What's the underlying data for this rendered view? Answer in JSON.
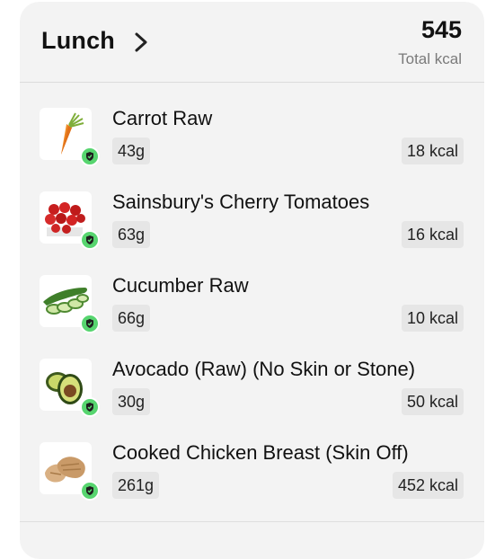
{
  "meal": {
    "title": "Lunch",
    "total_value": "545",
    "total_label": "Total kcal"
  },
  "items": [
    {
      "name": "Carrot Raw",
      "weight": "43g",
      "kcal": "18 kcal",
      "icon": "carrot-icon"
    },
    {
      "name": "Sainsbury's Cherry Tomatoes",
      "weight": "63g",
      "kcal": "16 kcal",
      "icon": "tomatoes-icon"
    },
    {
      "name": "Cucumber Raw",
      "weight": "66g",
      "kcal": "10 kcal",
      "icon": "cucumber-icon"
    },
    {
      "name": "Avocado (Raw) (No Skin or Stone)",
      "weight": "30g",
      "kcal": "50 kcal",
      "icon": "avocado-icon"
    },
    {
      "name": "Cooked Chicken Breast (Skin Off)",
      "weight": "261g",
      "kcal": "452 kcal",
      "icon": "chicken-icon"
    }
  ],
  "colors": {
    "card_bg": "#f3f3f3",
    "verified_badge": "#57d56f",
    "pill_bg": "#e6e6e6"
  }
}
